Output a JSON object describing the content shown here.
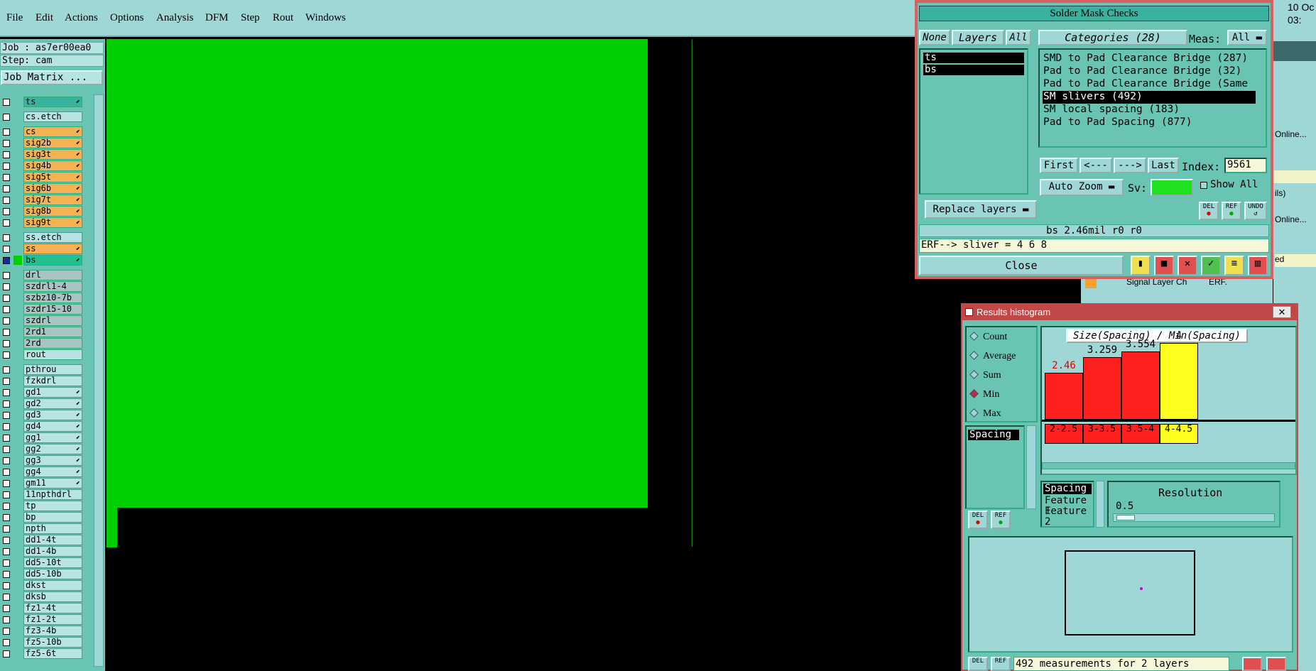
{
  "menubar": {
    "items": [
      "File",
      "Edit",
      "Actions",
      "Options",
      "Analysis",
      "DFM",
      "Step",
      "Rout",
      "Windows"
    ]
  },
  "left": {
    "job": "Job : as7er00ea0",
    "step": "Step: cam",
    "job_matrix": "Job Matrix ...",
    "layers": [
      {
        "name": "ts",
        "color": "teal",
        "arrow": true
      },
      {
        "name": "cs.etch",
        "color": "ltc",
        "arrow": false
      },
      {
        "name": "cs",
        "color": "org",
        "arrow": true
      },
      {
        "name": "sig2b",
        "color": "org",
        "arrow": true
      },
      {
        "name": "sig3t",
        "color": "org",
        "arrow": true
      },
      {
        "name": "sig4b",
        "color": "org",
        "arrow": true
      },
      {
        "name": "sig5t",
        "color": "org",
        "arrow": true
      },
      {
        "name": "sig6b",
        "color": "org",
        "arrow": true
      },
      {
        "name": "sig7t",
        "color": "org",
        "arrow": true
      },
      {
        "name": "sig8b",
        "color": "org",
        "arrow": true
      },
      {
        "name": "sig9t",
        "color": "org",
        "arrow": true
      },
      {
        "name": "ss.etch",
        "color": "ltc",
        "arrow": false
      },
      {
        "name": "ss",
        "color": "org",
        "arrow": true
      },
      {
        "name": "bs",
        "color": "grn",
        "arrow": true
      },
      {
        "name": "drl",
        "color": "gry",
        "arrow": false
      },
      {
        "name": "szdrl1-4",
        "color": "gry",
        "arrow": false
      },
      {
        "name": "szbz10-7b",
        "color": "gry",
        "arrow": false
      },
      {
        "name": "szdr15-10",
        "color": "gry",
        "arrow": false
      },
      {
        "name": "szdrl",
        "color": "gry",
        "arrow": false
      },
      {
        "name": "2rd1",
        "color": "gry",
        "arrow": false
      },
      {
        "name": "2rd",
        "color": "gry",
        "arrow": false
      },
      {
        "name": "rout",
        "color": "ltc",
        "arrow": false
      },
      {
        "name": "pthrou",
        "color": "ltc",
        "arrow": false
      },
      {
        "name": "fzkdrl",
        "color": "ltc",
        "arrow": false
      },
      {
        "name": "gd1",
        "color": "ltc",
        "arrow": true
      },
      {
        "name": "gd2",
        "color": "ltc",
        "arrow": true
      },
      {
        "name": "gd3",
        "color": "ltc",
        "arrow": true
      },
      {
        "name": "gd4",
        "color": "ltc",
        "arrow": true
      },
      {
        "name": "gg1",
        "color": "ltc",
        "arrow": true
      },
      {
        "name": "gg2",
        "color": "ltc",
        "arrow": true
      },
      {
        "name": "gg3",
        "color": "ltc",
        "arrow": true
      },
      {
        "name": "gg4",
        "color": "ltc",
        "arrow": true
      },
      {
        "name": "gm11",
        "color": "ltc",
        "arrow": true
      },
      {
        "name": "11npthdrl",
        "color": "ltc",
        "arrow": false
      },
      {
        "name": "tp",
        "color": "ltc",
        "arrow": false
      },
      {
        "name": "bp",
        "color": "ltc",
        "arrow": false
      },
      {
        "name": "npth",
        "color": "ltc",
        "arrow": false
      },
      {
        "name": "dd1-4t",
        "color": "ltc",
        "arrow": false
      },
      {
        "name": "dd1-4b",
        "color": "ltc",
        "arrow": false
      },
      {
        "name": "dd5-10t",
        "color": "ltc",
        "arrow": false
      },
      {
        "name": "dd5-10b",
        "color": "ltc",
        "arrow": false
      },
      {
        "name": "dkst",
        "color": "ltc",
        "arrow": false
      },
      {
        "name": "dksb",
        "color": "ltc",
        "arrow": false
      },
      {
        "name": "fz1-4t",
        "color": "ltc",
        "arrow": false
      },
      {
        "name": "fz1-2t",
        "color": "ltc",
        "arrow": false
      },
      {
        "name": "fz3-4b",
        "color": "ltc",
        "arrow": false
      },
      {
        "name": "fz5-10b",
        "color": "ltc",
        "arrow": false
      },
      {
        "name": "fz5-6t",
        "color": "ltc",
        "arrow": false
      }
    ]
  },
  "colors": {
    "teal": "#39b39f",
    "ltc": "#b7e3e3",
    "org": "#f6b252",
    "gry": "#a9c3c3",
    "grn": "#20c090",
    "canvas_green": "#00d000"
  },
  "solder": {
    "title": "Solder Mask Checks",
    "none": "None",
    "layers_tab": "Layers",
    "all": "All",
    "categories": "Categories (28)",
    "meas_label": "Meas:",
    "meas_value": "All",
    "layer_items": [
      "ts",
      "bs"
    ],
    "cat_items": [
      "SMD to Pad Clearance Bridge (287)",
      "Pad to Pad Clearance Bridge (32)",
      "Pad to Pad Clearance Bridge (Same",
      "SM slivers (492)",
      "SM local spacing (183)",
      "Pad to Pad Spacing (877)"
    ],
    "first": "First",
    "prev": "<---",
    "next": "--->",
    "last": "Last",
    "index_label": "Index:",
    "index_value": "9561",
    "auto_zoom": "Auto Zoom",
    "sv": "Sv:",
    "show_all": "Show All",
    "replace": "Replace layers",
    "del": "DEL",
    "ref": "REF",
    "undo": "UNDO",
    "status": "bs 2.46mil  r0  r0",
    "erf": "ERF--> sliver = 4 6 8",
    "close": "Close"
  },
  "hist": {
    "title": "Results histogram",
    "radios": [
      "Count",
      "Average",
      "Sum",
      "Min",
      "Max"
    ],
    "selected": "Min",
    "side_list": [
      "Spacing"
    ],
    "chart_title": "Size(Spacing) / Min(Spacing)",
    "resolution_label": "Resolution",
    "resolution": "0.5",
    "lower_list": [
      "Spacing",
      "Feature 1",
      "Feature 2"
    ],
    "footer": "492 measurements for 2 layers",
    "del": "DEL",
    "ref": "REF"
  },
  "chart_data": {
    "type": "bar",
    "title": "Size(Spacing) / Min(Spacing)",
    "categories": [
      "2-2.5",
      "3-3.5",
      "3.5-4",
      "4-4.5"
    ],
    "values": [
      2.46,
      3.259,
      3.554,
      4
    ],
    "value_labels": [
      "2.46",
      "3.259",
      "3.554",
      "4"
    ],
    "ylim": [
      0,
      4.4
    ],
    "colors": [
      "#ff2020",
      "#ff2020",
      "#ff2020",
      "#ffff20"
    ]
  },
  "right": {
    "clock1": "10 Oc",
    "clock2": "03:",
    "online1": "Online...",
    "online2": "Online...",
    "ils": "ils)",
    "ed": "ed",
    "signal": "Signal Layer Ch",
    "erf": "ERF."
  }
}
